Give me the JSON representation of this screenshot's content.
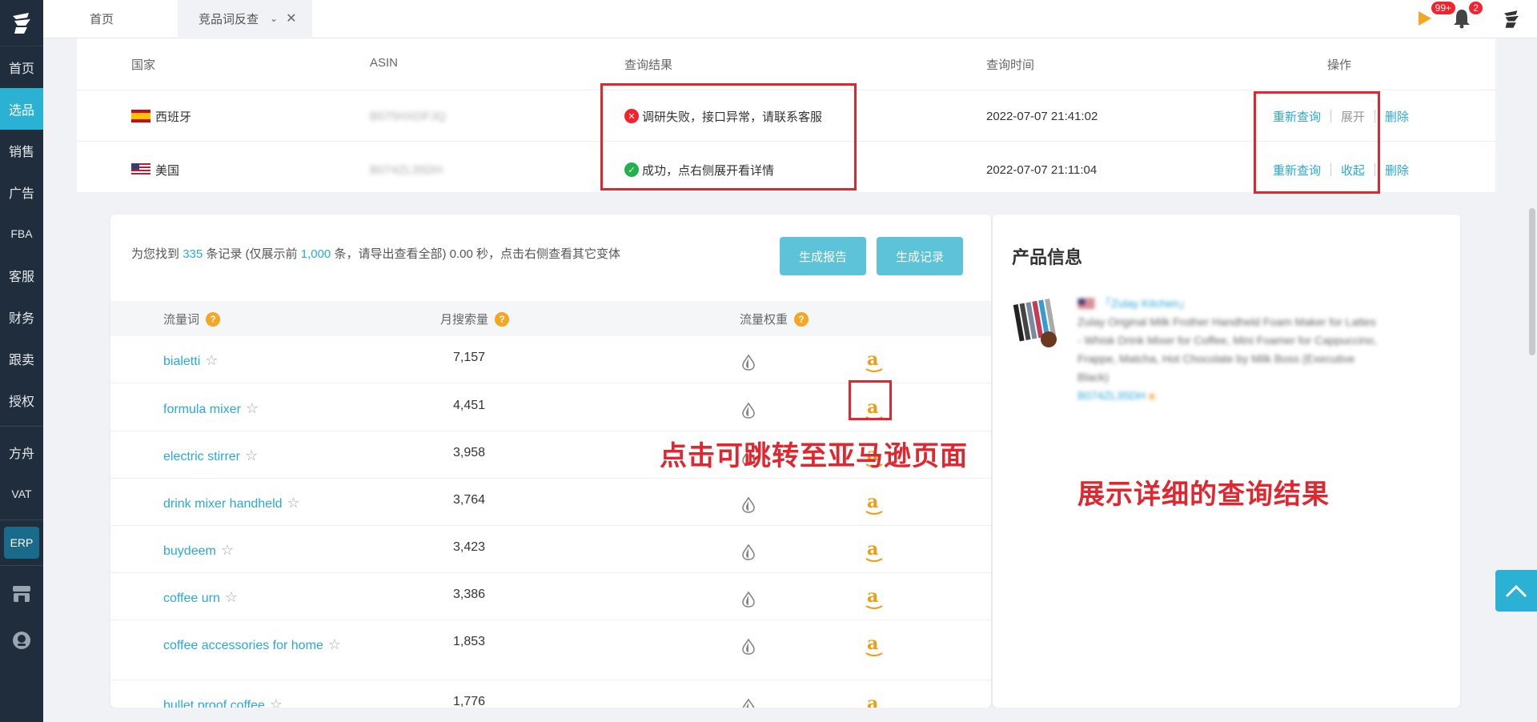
{
  "nav": {
    "items": [
      "首页",
      "选品",
      "销售",
      "广告",
      "FBA",
      "客服",
      "财务",
      "跟卖",
      "授权",
      "方舟",
      "VAT"
    ],
    "erp": "ERP"
  },
  "tabs": {
    "home": "首页",
    "current": "竞品词反查"
  },
  "badges": {
    "messages": "99+",
    "notifications": "2"
  },
  "query_table": {
    "headers": [
      "国家",
      "ASIN",
      "查询结果",
      "查询时间",
      "操作"
    ],
    "rows": [
      {
        "country": "西班牙",
        "asin": "B075HXDFJQ",
        "result": "调研失败，接口异常，请联系客服",
        "time": "2022-07-07 21:41:02",
        "ops": [
          "重新查询",
          "展开",
          "删除"
        ]
      },
      {
        "country": "美国",
        "asin": "B074ZL35DH",
        "result": "成功，点右侧展开看详情",
        "time": "2022-07-07 21:11:04",
        "ops": [
          "重新查询",
          "收起",
          "删除"
        ]
      }
    ]
  },
  "summary": {
    "p1": "为您找到",
    "count": "335",
    "p2": "条记录 (仅展示前",
    "limit": "1,000",
    "p3": "条，请导出查看全部) 0.00 秒，点击右侧查看其它变体"
  },
  "buttons": {
    "report": "生成报告",
    "record": "生成记录"
  },
  "kw_headers": {
    "word": "流量词",
    "volume": "月搜索量",
    "weight": "流量权重",
    "q": "?"
  },
  "keywords": [
    {
      "word": "bialetti",
      "volume": "7,157"
    },
    {
      "word": "formula mixer",
      "volume": "4,451"
    },
    {
      "word": "electric stirrer",
      "volume": "3,958"
    },
    {
      "word": "drink mixer handheld",
      "volume": "3,764"
    },
    {
      "word": "buydeem",
      "volume": "3,423"
    },
    {
      "word": "coffee urn",
      "volume": "3,386"
    },
    {
      "word": "coffee accessories for home",
      "volume": "1,853"
    },
    {
      "word": "bullet proof coffee",
      "volume": "1,776"
    }
  ],
  "amazon_glyph": "a",
  "star_glyph": "☆",
  "annotations": {
    "amazon_jump": "点击可跳转至亚马逊页面",
    "detail": "展示详细的查询结果"
  },
  "product_info": {
    "title": "产品信息",
    "brand": "「Zulay Kitchen」",
    "description": "Zulay Original Milk Frother Handheld Foam Maker for Lattes - Whisk Drink Mixer for Coffee, Mini Foamer for Cappuccino, Frappe, Matcha, Hot Chocolate by Milk Boss (Executive Black)",
    "asin": "B074ZL35DH"
  },
  "colors": {
    "accent": "#2bb1d3",
    "link": "#2ba8d8",
    "sidebar": "#1f2d3d",
    "annotation": "#e0262f",
    "amazon": "#f39c12"
  }
}
